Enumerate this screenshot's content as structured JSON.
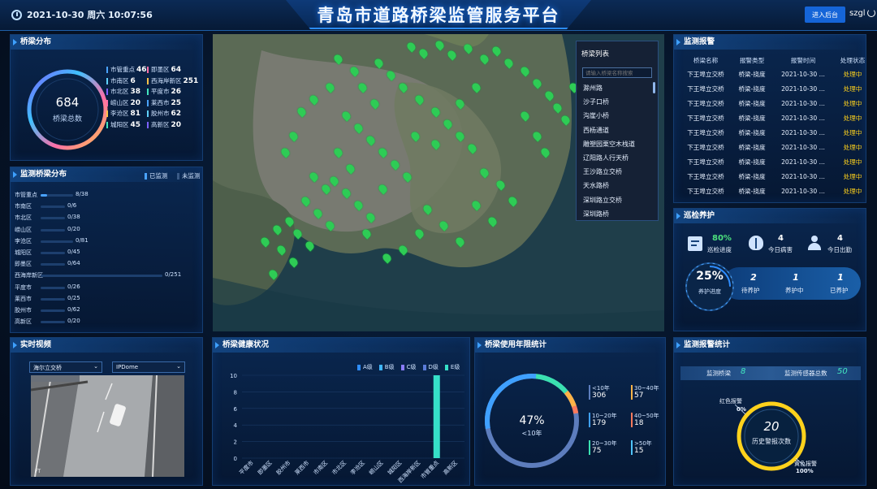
{
  "header": {
    "datetime": "2021-10-30 周六 10:07:56",
    "title": "青岛市道路桥梁监管服务平台",
    "admin_button": "进入后台",
    "user": "szgl"
  },
  "bridge_dist": {
    "title": "桥梁分布",
    "total": "684",
    "total_label": "桥梁总数",
    "left": [
      {
        "name": "市管重点",
        "value": "46"
      },
      {
        "name": "市南区",
        "value": "6"
      },
      {
        "name": "市北区",
        "value": "38"
      },
      {
        "name": "崂山区",
        "value": "20"
      },
      {
        "name": "李沧区",
        "value": "81"
      },
      {
        "name": "城阳区",
        "value": "45"
      }
    ],
    "right": [
      {
        "name": "即墨区",
        "value": "64"
      },
      {
        "name": "西海岸新区",
        "value": "251"
      },
      {
        "name": "平度市",
        "value": "26"
      },
      {
        "name": "莱西市",
        "value": "25"
      },
      {
        "name": "胶州市",
        "value": "62"
      },
      {
        "name": "高新区",
        "value": "20"
      }
    ]
  },
  "monitor_dist": {
    "title": "监测桥梁分布",
    "legend_on": "已监测",
    "legend_off": "未监测",
    "rows": [
      {
        "name": "市管重点",
        "value": "8/38",
        "ratio": 0.21
      },
      {
        "name": "市南区",
        "value": "0/6",
        "ratio": 0
      },
      {
        "name": "市北区",
        "value": "0/38",
        "ratio": 0
      },
      {
        "name": "崂山区",
        "value": "0/20",
        "ratio": 0
      },
      {
        "name": "李沧区",
        "value": "0/81",
        "ratio": 0
      },
      {
        "name": "城阳区",
        "value": "0/45",
        "ratio": 0
      },
      {
        "name": "即墨区",
        "value": "0/64",
        "ratio": 0
      },
      {
        "name": "西海岸新区",
        "value": "0/251",
        "ratio": 0
      },
      {
        "name": "平度市",
        "value": "0/26",
        "ratio": 0
      },
      {
        "name": "莱西市",
        "value": "0/25",
        "ratio": 0
      },
      {
        "name": "胶州市",
        "value": "0/62",
        "ratio": 0
      },
      {
        "name": "高新区",
        "value": "0/20",
        "ratio": 0
      }
    ]
  },
  "bridge_list": {
    "title": "桥梁列表",
    "search_placeholder": "请输入桥梁名称搜索",
    "items": [
      "滁州路",
      "沙子口桥",
      "沟崖小桥",
      "西杨通道",
      "雕塑园栗空木栈道",
      "辽阳路人行天桥",
      "王沙路立交桥",
      "天水路桥",
      "深圳路立交桥",
      "深圳路桥"
    ]
  },
  "alarm": {
    "title": "监测报警",
    "headers": [
      "桥梁名称",
      "报警类型",
      "报警时间",
      "处理状态"
    ],
    "rows": [
      [
        "下王埠立交桥",
        "桥梁-挠度",
        "2021-10-30 ...",
        "处理中"
      ],
      [
        "下王埠立交桥",
        "桥梁-挠度",
        "2021-10-30 ...",
        "处理中"
      ],
      [
        "下王埠立交桥",
        "桥梁-挠度",
        "2021-10-30 ...",
        "处理中"
      ],
      [
        "下王埠立交桥",
        "桥梁-挠度",
        "2021-10-30 ...",
        "处理中"
      ],
      [
        "下王埠立交桥",
        "桥梁-挠度",
        "2021-10-30 ...",
        "处理中"
      ],
      [
        "下王埠立交桥",
        "桥梁-挠度",
        "2021-10-30 ...",
        "处理中"
      ],
      [
        "下王埠立交桥",
        "桥梁-挠度",
        "2021-10-30 ...",
        "处理中"
      ],
      [
        "下王埠立交桥",
        "桥梁-挠度",
        "2021-10-30 ...",
        "处理中"
      ],
      [
        "下王埠立交桥",
        "桥梁-挠度",
        "2021-10-30 ...",
        "处理中"
      ]
    ]
  },
  "inspection": {
    "title": "巡检养护",
    "progress": "80%",
    "progress_label": "巡检进度",
    "disease": "4",
    "disease_label": "今日病害",
    "attend": "4",
    "attend_label": "今日出勤",
    "maint_pct": "25%",
    "maint_label": "养护进度",
    "pending": "2",
    "pending_label": "待养护",
    "in_progress": "1",
    "in_progress_label": "养护中",
    "done": "1",
    "done_label": "已养护"
  },
  "video": {
    "title": "实时视频",
    "bridge_select": "海尔立交桥",
    "camera_select": "IPDome",
    "watermark": "FT"
  },
  "health": {
    "title": "桥梁健康状况",
    "legend": [
      "A级",
      "B级",
      "C级",
      "D级",
      "E级"
    ],
    "colors": [
      "#2f8dff",
      "#3fb6ff",
      "#8a7cff",
      "#5a7bd8",
      "#36e0c8"
    ]
  },
  "age": {
    "title": "桥梁使用年限统计",
    "pct": "47%",
    "pct_label": "<10年",
    "items": [
      {
        "label": "<10年",
        "value": "306",
        "color": "#5d7dbd"
      },
      {
        "label": "30~40年",
        "value": "57",
        "color": "#ffb347"
      },
      {
        "label": "10~20年",
        "value": "179",
        "color": "#3fa0ff"
      },
      {
        "label": "40~50年",
        "value": "18",
        "color": "#ff7a5c"
      },
      {
        "label": "20~30年",
        "value": "75",
        "color": "#3be0b0"
      },
      {
        "label": ">50年",
        "value": "15",
        "color": "#4fc3ff"
      }
    ]
  },
  "alarm_stat": {
    "title": "监测报警统计",
    "monitored_label": "监测桥梁",
    "monitored": "8",
    "sensor_label": "监测传感器总数",
    "sensor": "50",
    "red_label": "红色报警",
    "red_pct": "0%",
    "yellow_label": "黄色报警",
    "yellow_pct": "100%",
    "history": "20",
    "history_label": "历史警报次数"
  },
  "chart_data": {
    "type": "bar",
    "title": "桥梁健康状况",
    "categories": [
      "平度市",
      "即墨区",
      "胶州市",
      "莱西市",
      "市南区",
      "市北区",
      "李沧区",
      "崂山区",
      "城阳区",
      "西海岸新区",
      "市管重点",
      "高新区"
    ],
    "series": [
      {
        "name": "A级",
        "values": [
          0,
          0,
          0,
          0,
          0,
          0,
          0,
          0,
          0,
          0,
          0,
          0
        ]
      },
      {
        "name": "B级",
        "values": [
          0,
          0,
          0,
          0,
          0,
          0,
          0,
          0,
          0,
          0,
          0,
          0
        ]
      },
      {
        "name": "C级",
        "values": [
          0,
          0,
          0,
          0,
          0,
          0,
          0,
          0,
          0,
          0,
          0,
          0
        ]
      },
      {
        "name": "D级",
        "values": [
          0,
          0,
          0,
          0,
          0,
          0,
          0,
          0,
          0,
          0,
          0,
          0
        ]
      },
      {
        "name": "E级",
        "values": [
          0,
          0,
          0,
          0,
          0,
          0,
          0,
          0,
          0,
          0,
          10,
          0
        ]
      }
    ],
    "yticks": [
      "0",
      "2",
      "4",
      "6",
      "8",
      "10"
    ],
    "ylim": [
      0,
      10
    ]
  }
}
